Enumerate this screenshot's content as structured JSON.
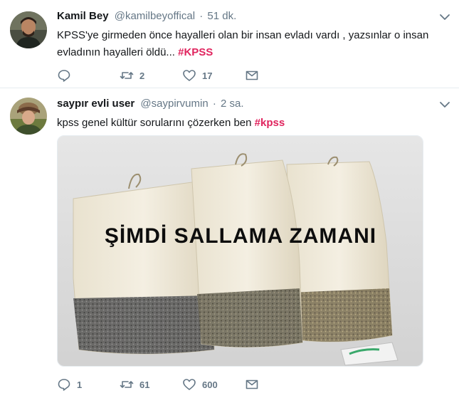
{
  "tweets": [
    {
      "fullname": "Kamil Bey",
      "username": "@kamilbeyoffical",
      "time": "51 dk.",
      "text_line1": "KPSS'ye girmeden önce hayalleri olan bir insan evladı vardı , yazsınlar o insan",
      "text_line2": "evladının hayalleri öldü...",
      "hashtag": "#KPSS",
      "replies": "",
      "retweets": "2",
      "likes": "17"
    },
    {
      "fullname": "saypır evli user",
      "username": "@saypirvumin",
      "time": "2 sa.",
      "text": "kpss genel kültür sorularını çözerken ben",
      "hashtag": "#kpss",
      "media_caption": "ŞİMDİ SALLAMA ZAMANI",
      "replies": "1",
      "retweets": "61",
      "likes": "600"
    }
  ],
  "colors": {
    "hashtag": "#e0245e",
    "secondary_text": "#657786",
    "divider": "#e6ecf0"
  },
  "icons": [
    "reply-icon",
    "retweet-icon",
    "like-icon",
    "message-icon",
    "chevron-down-icon"
  ]
}
